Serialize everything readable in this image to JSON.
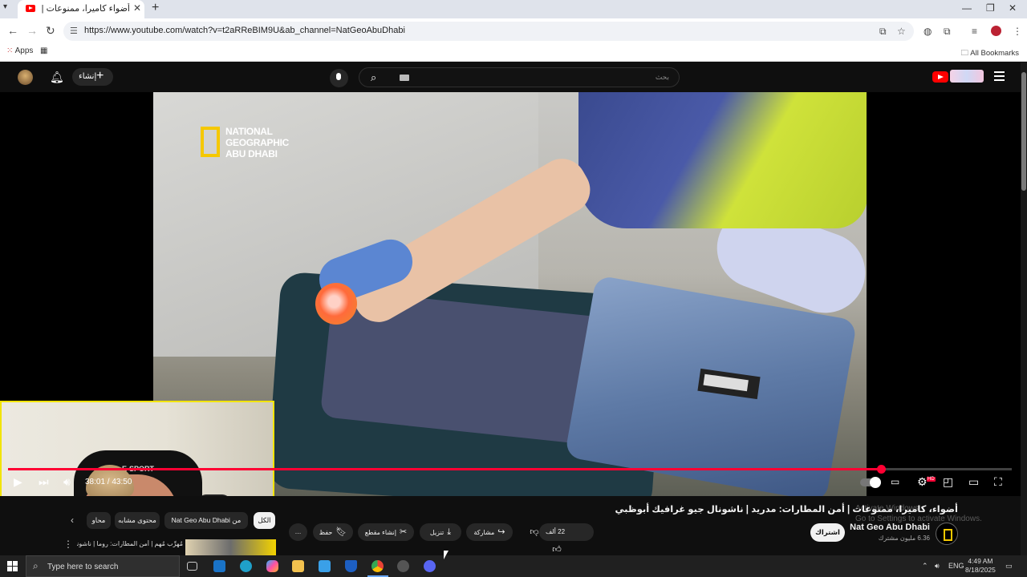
{
  "browser": {
    "tab_title": "أضواء كاميرا، ممنوعات | أمن المطارات",
    "url": "https://www.youtube.com/watch?v=t2aRReBIM9U&ab_channel=NatGeoAbuDhabi",
    "bookmarks": {
      "apps_label": "Apps",
      "all_bookmarks_label": "All Bookmarks"
    }
  },
  "youtube": {
    "create_label": "إنشاء",
    "search_placeholder": "بحث",
    "video": {
      "brand_logo_lines": [
        "NATIONAL",
        "GEOGRAPHIC",
        "ABU DHABI"
      ],
      "webcam_chair_text": "E-SPORT",
      "progress_fraction": 0.87,
      "time_display": "38:01 / 43:50"
    },
    "title": "أضواء، كاميرا، ممنوعات | أمن المطارات: مدريد | ناشونال جيو غرافيك أبوظبي",
    "channel": {
      "name": "Nat Geo Abu Dhabi",
      "subscribers": "6.36 مليون مشترك",
      "subscribe_label": "اشتراك"
    },
    "actions": {
      "likes": "22 ألف",
      "share": "مشاركة",
      "download": "تنزيل",
      "clip": "إنشاء مقطع",
      "save": "حفظ",
      "more": "…"
    },
    "chips": [
      "الكل",
      "من Nat Geo Abu Dhabi",
      "محتوى مشابه",
      "محاو"
    ],
    "recommendation_title": "مُهرِّب مُهم | أمن المطارات: روما | ناشونال جيو غرافيك أبوظبي"
  },
  "overlay": {
    "watermark_lines": [
      "Activate Windows",
      "Go to Settings to activate Windows."
    ]
  },
  "taskbar": {
    "search_placeholder": "Type here to search",
    "language": "ENG",
    "time": "4:49 AM",
    "date": "8/18/2025"
  },
  "colors": {
    "accent_red": "#ff0033",
    "youtube_red": "#ff0000",
    "natgeo_yellow": "#f5c800"
  }
}
